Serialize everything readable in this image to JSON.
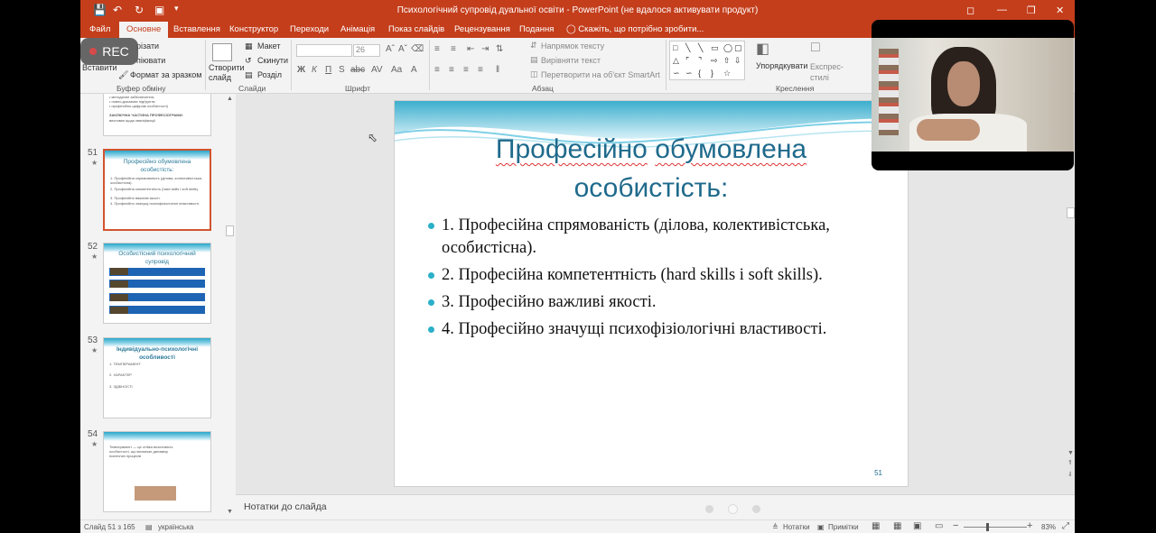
{
  "window": {
    "title": "Психологічний супровід дуальної освіти - PowerPoint (не вдалося активувати продукт)"
  },
  "tabs": [
    {
      "label": "Файл"
    },
    {
      "label": "Основне"
    },
    {
      "label": "Вставлення"
    },
    {
      "label": "Конструктор"
    },
    {
      "label": "Переходи"
    },
    {
      "label": "Анімація"
    },
    {
      "label": "Показ слайдів"
    },
    {
      "label": "Рецензування"
    },
    {
      "label": "Подання"
    }
  ],
  "tell_me": "Скажіть, що потрібно зробити...",
  "rec_label": "REC",
  "ribbon": {
    "insert_label": "Вставити",
    "cut_label": "різати",
    "copy_label": "піювати",
    "format_painter_label": "Формат за зразком",
    "clipboard_group": "Буфер обміну",
    "layout_label": "Макет",
    "reset_label": "Скинути",
    "section_label": "Розділ",
    "new_slide_label": "Створити слайд",
    "slides_group": "Слайди",
    "font_size": "26",
    "font_group": "Шрифт",
    "text_direction_label": "Напрямок тексту",
    "align_text_label": "Вирівняти текст",
    "smartart_label": "Перетворити на об'єкт SmartArt",
    "paragraph_group": "Абзац",
    "arrange_label": "Упорядкувати",
    "quick_styles_label": "Експрес-стилі",
    "drawing_group": "Креслення",
    "font_buttons": [
      "Ж",
      "К",
      "П",
      "S",
      "abc",
      "AV",
      "Aa",
      "A"
    ]
  },
  "thumbnails": [
    {
      "num": "",
      "title": "",
      "lines": [
        "• методичне забезпечення;",
        "• повно-доказове підґрунтя;",
        "• професійно-цифрові особистості)",
        "ЗАКЛЮЧНА ЧАСТИНА ПРОФЕСІОГРАМИ:",
        "висновки щодо кваліфікації"
      ]
    },
    {
      "num": "51",
      "title": "Професійно обумовлена особистість:",
      "lines": [
        "1. Професійна спрямованість (ділова, колективістська, особистісна).",
        "2. Професійна компетентність (hard skills i soft skills).",
        "3. Професійно важливі якості.",
        "4. Професійно значущі психофізіологічні властивості."
      ]
    },
    {
      "num": "52",
      "title": "Особистісний психологічний супровід",
      "lines": []
    },
    {
      "num": "53",
      "title": "Індивідуально-психологічні особливості",
      "lines": [
        "1. ТЕМПЕРАМЕНТ",
        "2. ХАРАКТЕР",
        "3. ЗДІБНОСТІ"
      ]
    },
    {
      "num": "54",
      "title": "",
      "lines": [
        "Темперамент — це стійка властивість особистості, що визначає динаміку психічних процесів"
      ]
    }
  ],
  "slide": {
    "title_line1_word1": "Професійно",
    "title_line1_word2": "обумовлена",
    "title_line2": "особистість:",
    "bullets": [
      "1. Професійна спрямованість (ділова, колективістська, особистісна).",
      "2. Професійна компетентність (hard skills і soft skills).",
      "3. Професійно важливі  якості.",
      "4. Професійно значущі психофізіологічні властивості."
    ],
    "number": "51"
  },
  "notes_label": "Нотатки до слайда",
  "status": {
    "slide_counter": "Слайд 51 з 165",
    "language": "українська",
    "notes_btn": "Нотатки",
    "comments_btn": "Примітки",
    "zoom": "83%"
  },
  "colors": {
    "accent": "#c43e1c",
    "title_blue": "#1f6a8c",
    "bullet_teal": "#2ab0c8"
  }
}
